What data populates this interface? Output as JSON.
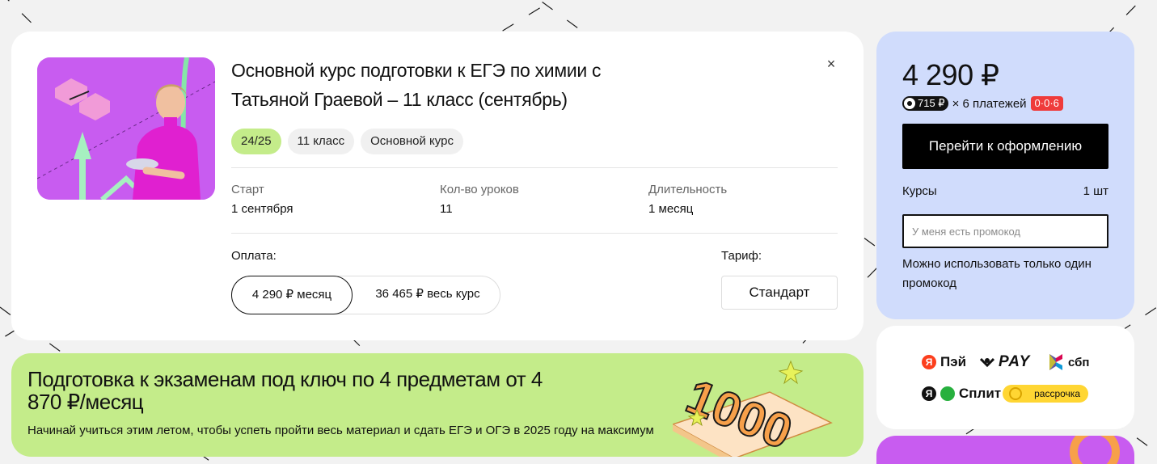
{
  "course": {
    "title": "Основной курс подготовки к ЕГЭ по химии с Татьяной Граевой – 11 класс (сентябрь)",
    "tags": [
      "24/25",
      "11 класс",
      "Основной курс"
    ],
    "info": [
      {
        "label": "Старт",
        "value": "1 сентября"
      },
      {
        "label": "Кол-во уроков",
        "value": "11"
      },
      {
        "label": "Длительность",
        "value": "1 месяц"
      }
    ],
    "payment_label": "Оплата:",
    "payment_options": [
      "4 290 ₽ месяц",
      "36 465 ₽ весь курс"
    ],
    "tariff_label": "Тариф:",
    "tariff_value": "Стандарт",
    "close_icon": "×"
  },
  "price": {
    "amount": "4 290 ₽",
    "split_amount": "715 ₽",
    "installment_text": "× 6 платежей",
    "installment_badge": "0·0·6",
    "checkout_label": "Перейти к оформлению",
    "courses_label": "Курсы",
    "courses_count": "1 шт",
    "promo_placeholder": "У меня есть промокод",
    "promo_note": "Можно использовать только один промокод"
  },
  "payment_methods": {
    "yandex_pay": "Пэй",
    "yandex_letter": "Я",
    "sber_pay": "PAY",
    "sbp": "сбп",
    "split": "Сплит",
    "installment": "рассрочка"
  },
  "banner": {
    "title": "Подготовка к экзаменам под ключ по 4 предметам от 4 870 ₽/месяц",
    "text": "Начинай учиться этим летом, чтобы успеть пройти весь материал и сдать ЕГЭ и ОГЭ в 2025 году на максимум",
    "art_number": "1000"
  },
  "colors": {
    "accent_green": "#c4ec8a",
    "accent_blue": "#d0dcfc",
    "accent_purple": "#c85cf0",
    "badge_red": "#ef3b3b",
    "button_black": "#000000"
  }
}
